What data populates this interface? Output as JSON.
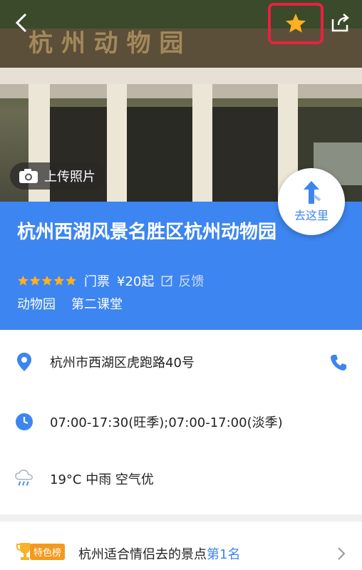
{
  "hero": {
    "sign_text": "杭 州 动 物 园",
    "upload_label": "上传照片"
  },
  "place": {
    "title": "杭州西湖风景名胜区杭州动物园",
    "rating_stars": 5,
    "ticket_label": "门票",
    "ticket_price": "¥20起",
    "feedback_label": "反馈",
    "tags": [
      "动物园",
      "第二课堂"
    ]
  },
  "goto": {
    "label": "去这里"
  },
  "details": {
    "address": "杭州市西湖区虎跑路40号",
    "hours": "07:00-17:30(旺季);07:00-17:00(淡季)",
    "weather": "19°C  中雨    空气优"
  },
  "ranking": {
    "badge": "特色榜",
    "text": "杭州适合情侣去的景点",
    "highlight": "第1名"
  },
  "colors": {
    "brand_blue": "#3d85f0",
    "star": "#ffb020",
    "highlight_box": "#e8213f"
  }
}
